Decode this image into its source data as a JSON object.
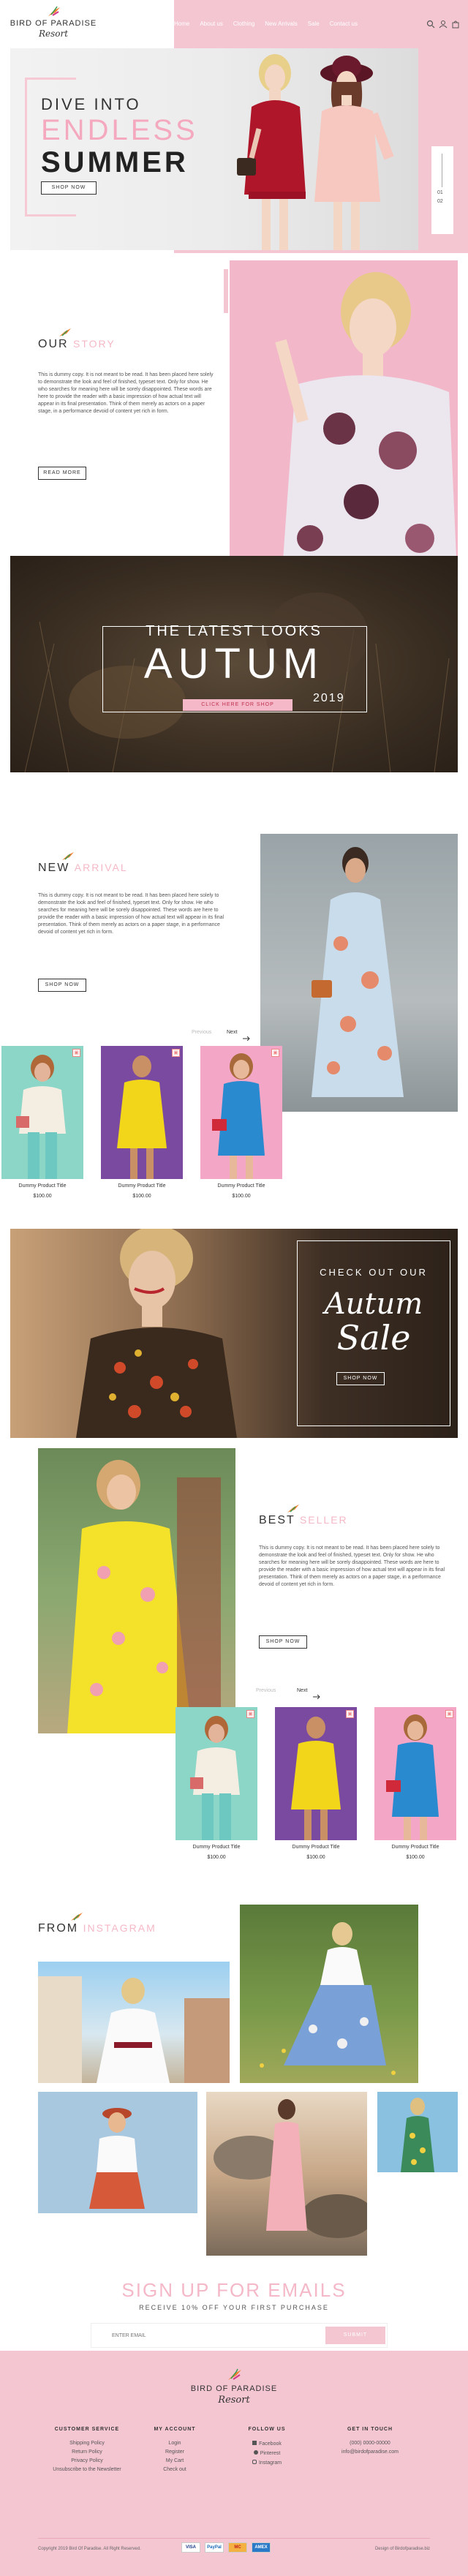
{
  "header": {
    "logo_line1": "BIRD OF PARADISE",
    "logo_line2": "Resort",
    "nav": [
      "Home",
      "About us",
      "Clothing",
      "New Arrivals",
      "Sale",
      "Contact us"
    ]
  },
  "hero": {
    "line1": "DIVE INTO",
    "line2": "ENDLESS",
    "line3": "SUMMER",
    "button": "SHOP NOW",
    "slide_prev": "01",
    "slide_next": "02",
    "colors": {
      "accent": "#f4a9bf",
      "pink_bg": "#f4c6d2"
    }
  },
  "story": {
    "title": "OUR",
    "title_accent": "STORY",
    "text": "This is dummy copy. It is not meant to be read. It has been placed here solely to demonstrate the look and feel of finished, typeset text. Only for show. He who searches for meaning here will be sorely disappointed. These words are here to provide the reader with a basic impression of how actual text will appear in its final presentation. Think of them merely as actors on a paper stage, in a performance devoid of content yet rich in form.",
    "button": "READ MORE"
  },
  "autumn": {
    "line1": "THE LATEST LOOKS",
    "line2": "AUTUM",
    "year": "2019",
    "button": "CLICK HERE FOR SHOP"
  },
  "arrival": {
    "title": "NEW",
    "title_accent": "ARRIVAL",
    "text": "This is dummy copy. It is not meant to be read. It has been placed here solely to demonstrate the look and feel of finished, typeset text. Only for show. He who searches for meaning here will be sorely disappointed. These words are here to provide the reader with a basic impression of how actual text will appear in its final presentation. Think of them merely as actors on a paper stage, in a performance devoid of content yet rich in form.",
    "button": "SHOP NOW",
    "prev": "Previous",
    "next": "Next",
    "products": [
      {
        "title": "Dummy Product Title",
        "price": "$100.00"
      },
      {
        "title": "Dummy Product Title",
        "price": "$100.00"
      },
      {
        "title": "Dummy Product Title",
        "price": "$100.00"
      }
    ]
  },
  "sale": {
    "line1": "CHECK OUT OUR",
    "line2": "Autum",
    "line3": "Sale",
    "button": "SHOP NOW"
  },
  "best": {
    "title": "BEST",
    "title_accent": "SELLER",
    "text": "This is dummy copy. It is not meant to be read. It has been placed here solely to demonstrate the look and feel of finished, typeset text. Only for show. He who searches for meaning here will be sorely disappointed. These words are here to provide the reader with a basic impression of how actual text will appear in its final presentation. Think of them merely as actors on a paper stage, in a performance devoid of content yet rich in form.",
    "button": "SHOP NOW",
    "prev": "Previous",
    "next": "Next",
    "products": [
      {
        "title": "Dummy Product Title",
        "price": "$100.00"
      },
      {
        "title": "Dummy Product Title",
        "price": "$100.00"
      },
      {
        "title": "Dummy Product Title",
        "price": "$100.00"
      }
    ]
  },
  "instagram": {
    "title": "FROM",
    "title_accent": "INSTAGRAM"
  },
  "signup": {
    "title": "SIGN UP FOR EMAILS",
    "subtitle": "RECEIVE 10% OFF YOUR FIRST PURCHASE",
    "placeholder": "ENTER EMAIL",
    "button": "SUBMIT"
  },
  "footer": {
    "logo_line1": "BIRD OF PARADISE",
    "logo_line2": "Resort",
    "columns": [
      {
        "heading": "CUSTOMER SERVICE",
        "items": [
          "Shipping Policy",
          "Return Policy",
          "Privacy Policy",
          "Unsubscribe to the Newsletter"
        ]
      },
      {
        "heading": "MY ACCOUNT",
        "items": [
          "Login",
          "Register",
          "My Cart",
          "Check out"
        ]
      },
      {
        "heading": "FOLLOW US",
        "items": [
          "Facebook",
          "Pinterest",
          "Instagram"
        ]
      },
      {
        "heading": "GET IN TOUCH",
        "items": [
          "(000) 0000-00000",
          "info@birdofparadise.com"
        ]
      }
    ],
    "copyright": "Copyright 2019 Bird Of Paradise. All Right Reserved.",
    "payments": [
      "VISA",
      "PayPal",
      "MC",
      "AMEX"
    ],
    "credit": "Design of Birdofparadise.biz"
  }
}
